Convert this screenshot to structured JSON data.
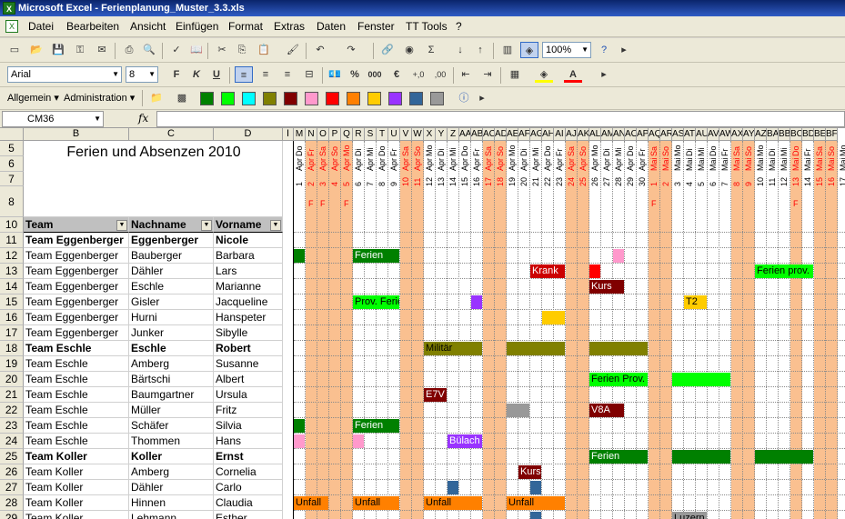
{
  "window": {
    "title": "Microsoft Excel - Ferienplanung_Muster_3.3.xls"
  },
  "menu": [
    "Datei",
    "Bearbeiten",
    "Ansicht",
    "Einfügen",
    "Format",
    "Extras",
    "Daten",
    "Fenster",
    "TT Tools",
    "?"
  ],
  "toolbar": {
    "zoom": "100%",
    "font": "Arial",
    "size": "8",
    "bold": "F",
    "italic": "K",
    "underline": "U",
    "percent": "%",
    "thousands": "000",
    "euro": "€",
    "text_color": "A"
  },
  "toolbar3": {
    "style": "Allgemein",
    "admin": "Administration"
  },
  "colors": {
    "green_dark": "#008000",
    "green": "#00ff00",
    "cyan": "#00ffff",
    "olive": "#808000",
    "maroon": "#800000",
    "pink": "#ff99cc",
    "red": "#ff0000",
    "orange": "#ff8000",
    "yellow": "#ffcc00",
    "purple": "#9933ff",
    "blue": "#336699",
    "grey": "#999999",
    "weekend": "#fac090"
  },
  "formula": {
    "namebox": "CM36",
    "fx": "fx"
  },
  "columns": {
    "B": "B",
    "C": "C",
    "D": "D",
    "letters": [
      "I",
      "M",
      "N",
      "O",
      "P",
      "Q",
      "R",
      "S",
      "T",
      "U",
      "V",
      "W",
      "X",
      "Y",
      "Z",
      "AA",
      "AB",
      "AC",
      "AD",
      "AE",
      "AF",
      "AG",
      "AH",
      "AI",
      "AJ",
      "AK",
      "AL",
      "AM",
      "AN",
      "AO",
      "AP",
      "AQ",
      "AR",
      "AS",
      "AT",
      "AU",
      "AV",
      "AW",
      "AX",
      "AY",
      "AZ",
      "BA",
      "BB",
      "BC",
      "BD",
      "BE",
      "BF"
    ]
  },
  "sheet": {
    "title": "Ferien und Absenzen 2010",
    "headers": {
      "team": "Team",
      "name": "Nachname",
      "vorname": "Vorname"
    },
    "rownums": [
      "5",
      "6",
      "7",
      "8",
      "10",
      "11",
      "12",
      "13",
      "14",
      "15",
      "16",
      "17",
      "18",
      "19",
      "20",
      "21",
      "22",
      "23",
      "24",
      "25",
      "26",
      "27",
      "28",
      "29"
    ],
    "rows": [
      {
        "team": "Team Eggenberger",
        "name": "Eggenberger",
        "vorname": "Nicole",
        "bold": true
      },
      {
        "team": "Team Eggenberger",
        "name": "Bauberger",
        "vorname": "Barbara"
      },
      {
        "team": "Team Eggenberger",
        "name": "Dähler",
        "vorname": "Lars"
      },
      {
        "team": "Team Eggenberger",
        "name": "Eschle",
        "vorname": "Marianne"
      },
      {
        "team": "Team Eggenberger",
        "name": "Gisler",
        "vorname": "Jacqueline"
      },
      {
        "team": "Team Eggenberger",
        "name": "Hurni",
        "vorname": "Hanspeter"
      },
      {
        "team": "Team Eggenberger",
        "name": "Junker",
        "vorname": "Sibylle"
      },
      {
        "team": "Team Eschle",
        "name": "Eschle",
        "vorname": "Robert",
        "bold": true
      },
      {
        "team": "Team Eschle",
        "name": "Amberg",
        "vorname": "Susanne"
      },
      {
        "team": "Team Eschle",
        "name": "Bärtschi",
        "vorname": "Albert"
      },
      {
        "team": "Team Eschle",
        "name": "Baumgartner",
        "vorname": "Ursula"
      },
      {
        "team": "Team Eschle",
        "name": "Müller",
        "vorname": "Fritz"
      },
      {
        "team": "Team Eschle",
        "name": "Schäfer",
        "vorname": "Silvia"
      },
      {
        "team": "Team Eschle",
        "name": "Thommen",
        "vorname": "Hans"
      },
      {
        "team": "Team Koller",
        "name": "Koller",
        "vorname": "Ernst",
        "bold": true
      },
      {
        "team": "Team Koller",
        "name": "Amberg",
        "vorname": "Cornelia"
      },
      {
        "team": "Team Koller",
        "name": "Dähler",
        "vorname": "Carlo"
      },
      {
        "team": "Team Koller",
        "name": "Hinnen",
        "vorname": "Claudia"
      },
      {
        "team": "Team Koller",
        "name": "Lehmann",
        "vorname": "Esther"
      }
    ],
    "days": [
      {
        "wd": "Do",
        "mon": "Apr",
        "d": "1",
        "we": false,
        "f": ""
      },
      {
        "wd": "Fr",
        "mon": "Apr",
        "d": "2",
        "we": true,
        "f": "F"
      },
      {
        "wd": "Sa",
        "mon": "Apr",
        "d": "3",
        "we": true,
        "f": "F"
      },
      {
        "wd": "So",
        "mon": "Apr",
        "d": "4",
        "we": true,
        "f": ""
      },
      {
        "wd": "Mo",
        "mon": "Apr",
        "d": "5",
        "we": true,
        "f": "F"
      },
      {
        "wd": "Di",
        "mon": "Apr",
        "d": "6",
        "we": false,
        "f": ""
      },
      {
        "wd": "Mi",
        "mon": "Apr",
        "d": "7",
        "we": false,
        "f": ""
      },
      {
        "wd": "Do",
        "mon": "Apr",
        "d": "8",
        "we": false,
        "f": ""
      },
      {
        "wd": "Fr",
        "mon": "Apr",
        "d": "9",
        "we": false,
        "f": ""
      },
      {
        "wd": "Sa",
        "mon": "Apr",
        "d": "10",
        "we": true,
        "f": ""
      },
      {
        "wd": "So",
        "mon": "Apr",
        "d": "11",
        "we": true,
        "f": ""
      },
      {
        "wd": "Mo",
        "mon": "Apr",
        "d": "12",
        "we": false,
        "f": ""
      },
      {
        "wd": "Di",
        "mon": "Apr",
        "d": "13",
        "we": false,
        "f": ""
      },
      {
        "wd": "Mi",
        "mon": "Apr",
        "d": "14",
        "we": false,
        "f": ""
      },
      {
        "wd": "Do",
        "mon": "Apr",
        "d": "15",
        "we": false,
        "f": ""
      },
      {
        "wd": "Fr",
        "mon": "Apr",
        "d": "16",
        "we": false,
        "f": ""
      },
      {
        "wd": "Sa",
        "mon": "Apr",
        "d": "17",
        "we": true,
        "f": ""
      },
      {
        "wd": "So",
        "mon": "Apr",
        "d": "18",
        "we": true,
        "f": ""
      },
      {
        "wd": "Mo",
        "mon": "Apr",
        "d": "19",
        "we": false,
        "f": ""
      },
      {
        "wd": "Di",
        "mon": "Apr",
        "d": "20",
        "we": false,
        "f": ""
      },
      {
        "wd": "Mi",
        "mon": "Apr",
        "d": "21",
        "we": false,
        "f": ""
      },
      {
        "wd": "Do",
        "mon": "Apr",
        "d": "22",
        "we": false,
        "f": ""
      },
      {
        "wd": "Fr",
        "mon": "Apr",
        "d": "23",
        "we": false,
        "f": ""
      },
      {
        "wd": "Sa",
        "mon": "Apr",
        "d": "24",
        "we": true,
        "f": ""
      },
      {
        "wd": "So",
        "mon": "Apr",
        "d": "25",
        "we": true,
        "f": ""
      },
      {
        "wd": "Mo",
        "mon": "Apr",
        "d": "26",
        "we": false,
        "f": ""
      },
      {
        "wd": "Di",
        "mon": "Apr",
        "d": "27",
        "we": false,
        "f": ""
      },
      {
        "wd": "Mi",
        "mon": "Apr",
        "d": "28",
        "we": false,
        "f": ""
      },
      {
        "wd": "Do",
        "mon": "Apr",
        "d": "29",
        "we": false,
        "f": ""
      },
      {
        "wd": "Fr",
        "mon": "Apr",
        "d": "30",
        "we": false,
        "f": ""
      },
      {
        "wd": "Sa",
        "mon": "Mai",
        "d": "1",
        "we": true,
        "f": "F"
      },
      {
        "wd": "So",
        "mon": "Mai",
        "d": "2",
        "we": true,
        "f": ""
      },
      {
        "wd": "Mo",
        "mon": "Mai",
        "d": "3",
        "we": false,
        "f": ""
      },
      {
        "wd": "Di",
        "mon": "Mai",
        "d": "4",
        "we": false,
        "f": ""
      },
      {
        "wd": "Mi",
        "mon": "Mai",
        "d": "5",
        "we": false,
        "f": ""
      },
      {
        "wd": "Do",
        "mon": "Mai",
        "d": "6",
        "we": false,
        "f": ""
      },
      {
        "wd": "Fr",
        "mon": "Mai",
        "d": "7",
        "we": false,
        "f": ""
      },
      {
        "wd": "Sa",
        "mon": "Mai",
        "d": "8",
        "we": true,
        "f": ""
      },
      {
        "wd": "So",
        "mon": "Mai",
        "d": "9",
        "we": true,
        "f": ""
      },
      {
        "wd": "Mo",
        "mon": "Mai",
        "d": "10",
        "we": false,
        "f": ""
      },
      {
        "wd": "Di",
        "mon": "Mai",
        "d": "11",
        "we": false,
        "f": ""
      },
      {
        "wd": "Mi",
        "mon": "Mai",
        "d": "12",
        "we": false,
        "f": ""
      },
      {
        "wd": "Do",
        "mon": "Mai",
        "d": "13",
        "we": true,
        "f": "F"
      },
      {
        "wd": "Fr",
        "mon": "Mai",
        "d": "14",
        "we": false,
        "f": ""
      },
      {
        "wd": "Sa",
        "mon": "Mai",
        "d": "15",
        "we": true,
        "f": ""
      },
      {
        "wd": "So",
        "mon": "Mai",
        "d": "16",
        "we": true,
        "f": ""
      },
      {
        "wd": "Mo",
        "mon": "Mai",
        "d": "17",
        "we": false,
        "f": ""
      }
    ],
    "events": [
      {
        "row": 1,
        "start": 0,
        "len": 1,
        "color": "#008000",
        "text": ""
      },
      {
        "row": 1,
        "start": 5,
        "len": 4,
        "color": "#008000",
        "text": "Ferien",
        "fg": "#fff"
      },
      {
        "row": 1,
        "start": 27,
        "len": 1,
        "color": "#ff99cc",
        "text": ""
      },
      {
        "row": 2,
        "start": 20,
        "len": 3,
        "color": "#cc0000",
        "text": "Krank",
        "fg": "#fff"
      },
      {
        "row": 2,
        "start": 25,
        "len": 1,
        "color": "#ff0000",
        "text": ""
      },
      {
        "row": 2,
        "start": 39,
        "len": 5,
        "color": "#00ff00",
        "text": "Ferien prov.",
        "fg": "#000"
      },
      {
        "row": 3,
        "start": 25,
        "len": 3,
        "color": "#800000",
        "text": "Kurs",
        "fg": "#fff"
      },
      {
        "row": 4,
        "start": 5,
        "len": 4,
        "color": "#00ff00",
        "text": "Prov. Ferien",
        "fg": "#000"
      },
      {
        "row": 4,
        "start": 15,
        "len": 1,
        "color": "#9933ff",
        "text": ""
      },
      {
        "row": 4,
        "start": 33,
        "len": 2,
        "color": "#ffcc00",
        "text": "T2",
        "fg": "#000"
      },
      {
        "row": 5,
        "start": 21,
        "len": 2,
        "color": "#ffcc00",
        "text": ""
      },
      {
        "row": 7,
        "start": 11,
        "len": 5,
        "color": "#808000",
        "text": "Militär",
        "fg": "#000"
      },
      {
        "row": 7,
        "start": 18,
        "len": 5,
        "color": "#808000",
        "text": ""
      },
      {
        "row": 7,
        "start": 25,
        "len": 5,
        "color": "#808000",
        "text": ""
      },
      {
        "row": 9,
        "start": 25,
        "len": 5,
        "color": "#00ff00",
        "text": "Ferien Prov.",
        "fg": "#000"
      },
      {
        "row": 9,
        "start": 32,
        "len": 5,
        "color": "#00ff00",
        "text": ""
      },
      {
        "row": 10,
        "start": 11,
        "len": 2,
        "color": "#800000",
        "text": "E7V",
        "fg": "#fff"
      },
      {
        "row": 11,
        "start": 18,
        "len": 2,
        "color": "#999999",
        "text": ""
      },
      {
        "row": 11,
        "start": 25,
        "len": 3,
        "color": "#800000",
        "text": "V8A",
        "fg": "#fff"
      },
      {
        "row": 12,
        "start": 0,
        "len": 1,
        "color": "#008000",
        "text": ""
      },
      {
        "row": 12,
        "start": 5,
        "len": 4,
        "color": "#008000",
        "text": "Ferien",
        "fg": "#fff"
      },
      {
        "row": 13,
        "start": 0,
        "len": 1,
        "color": "#ff99cc",
        "text": ""
      },
      {
        "row": 13,
        "start": 5,
        "len": 1,
        "color": "#ff99cc",
        "text": ""
      },
      {
        "row": 13,
        "start": 13,
        "len": 3,
        "color": "#9933ff",
        "text": "Bülach",
        "fg": "#fff"
      },
      {
        "row": 14,
        "start": 25,
        "len": 5,
        "color": "#008000",
        "text": "Ferien",
        "fg": "#fff"
      },
      {
        "row": 14,
        "start": 32,
        "len": 5,
        "color": "#008000",
        "text": ""
      },
      {
        "row": 14,
        "start": 39,
        "len": 5,
        "color": "#008000",
        "text": ""
      },
      {
        "row": 15,
        "start": 19,
        "len": 2,
        "color": "#800000",
        "text": "Kurs",
        "fg": "#fff"
      },
      {
        "row": 16,
        "start": 13,
        "len": 1,
        "color": "#336699",
        "text": ""
      },
      {
        "row": 16,
        "start": 20,
        "len": 1,
        "color": "#336699",
        "text": ""
      },
      {
        "row": 17,
        "start": 0,
        "len": 3,
        "color": "#ff8000",
        "text": "Unfall",
        "fg": "#000"
      },
      {
        "row": 17,
        "start": 5,
        "len": 4,
        "color": "#ff8000",
        "text": "Unfall",
        "fg": "#000"
      },
      {
        "row": 17,
        "start": 11,
        "len": 5,
        "color": "#ff8000",
        "text": "Unfall",
        "fg": "#000"
      },
      {
        "row": 17,
        "start": 18,
        "len": 5,
        "color": "#ff8000",
        "text": "Unfall",
        "fg": "#000"
      },
      {
        "row": 18,
        "start": 32,
        "len": 3,
        "color": "#999999",
        "text": "Luzern",
        "fg": "#000"
      },
      {
        "row": 18,
        "start": 20,
        "len": 1,
        "color": "#336699",
        "text": ""
      }
    ]
  }
}
